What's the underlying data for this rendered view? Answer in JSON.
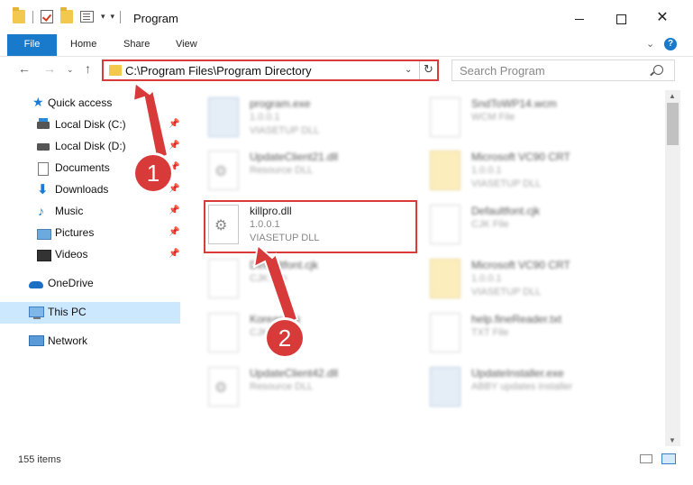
{
  "window": {
    "title": "Program",
    "buttons": {
      "minimize": "minimize",
      "maximize": "maximize",
      "close": "✕"
    }
  },
  "ribbon": {
    "tabs": [
      "File",
      "Home",
      "Share",
      "View"
    ],
    "help": "?"
  },
  "navbar": {
    "address": "C:\\Program Files\\Program Directory",
    "search_placeholder": "Search Program"
  },
  "sidebar": {
    "items": [
      {
        "label": "Quick access",
        "icon": "star-icon"
      },
      {
        "label": "Local Disk (C:)",
        "icon": "drive-icon"
      },
      {
        "label": "Local Disk (D:)",
        "icon": "drive-icon"
      },
      {
        "label": "Documents",
        "icon": "documents-icon"
      },
      {
        "label": "Downloads",
        "icon": "download-icon"
      },
      {
        "label": "Music",
        "icon": "music-icon"
      },
      {
        "label": "Pictures",
        "icon": "pictures-icon"
      },
      {
        "label": "Videos",
        "icon": "videos-icon"
      },
      {
        "label": "OneDrive",
        "icon": "cloud-icon"
      },
      {
        "label": "This PC",
        "icon": "computer-icon"
      },
      {
        "label": "Network",
        "icon": "network-icon"
      }
    ]
  },
  "files": [
    {
      "name": "program.exe",
      "version": "1.0.0.1",
      "type": "VIASETUP DLL"
    },
    {
      "name": "SndToWP14.wcm",
      "version": "WCM File",
      "type": ""
    },
    {
      "name": "UpdateClient21.dll",
      "version": "Resource DLL",
      "type": ""
    },
    {
      "name": "Microsoft VC90 CRT",
      "version": "1.0.0.1",
      "type": "VIASETUP DLL"
    },
    {
      "name": "killpro.dll",
      "version": "1.0.0.1",
      "type": "VIASETUP DLL"
    },
    {
      "name": "Defaultfont.cjk",
      "version": "CJK File",
      "type": ""
    },
    {
      "name": "Defaultfont.cjk",
      "version": "CJK File",
      "type": ""
    },
    {
      "name": "Microsoft VC90 CRT",
      "version": "1.0.0.1",
      "type": "VIASETUP DLL"
    },
    {
      "name": "Korean.cjk",
      "version": "CJK File",
      "type": ""
    },
    {
      "name": "help.fineReader.txt",
      "version": "TXT File",
      "type": ""
    },
    {
      "name": "UpdateClient42.dll",
      "version": "Resource DLL",
      "type": ""
    },
    {
      "name": "UpdateInstaller.exe",
      "version": "ABBY updates installer",
      "type": ""
    }
  ],
  "status": {
    "count": "155 items"
  },
  "callouts": [
    "1",
    "2"
  ],
  "colors": {
    "accent": "#1979ca",
    "highlight": "#d93a3a"
  }
}
